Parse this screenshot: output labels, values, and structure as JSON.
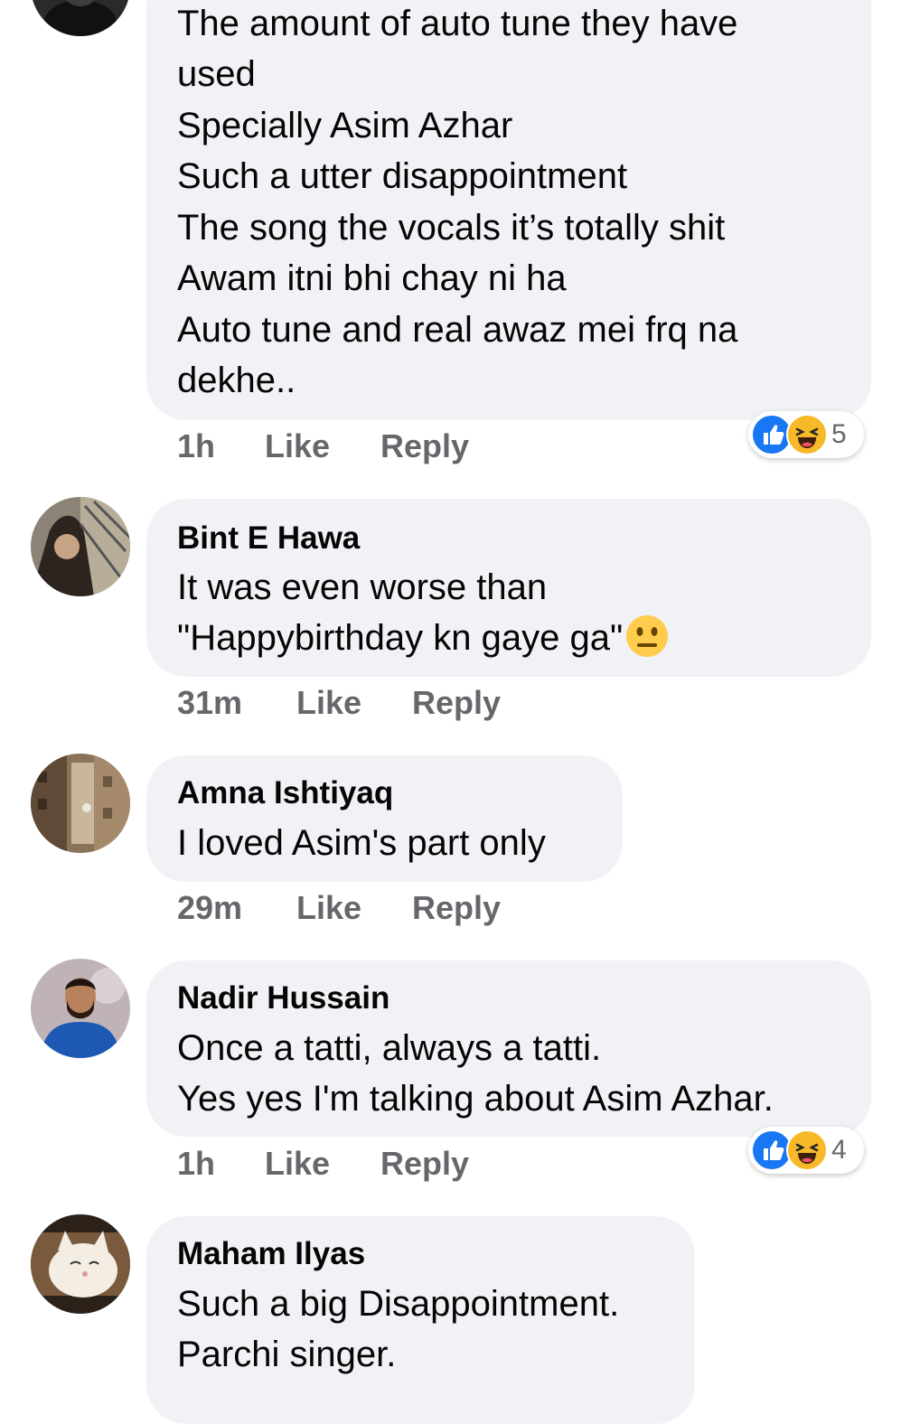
{
  "comments": [
    {
      "author": "",
      "lines": [
        "The amount of auto tune they have",
        "used",
        "Specially Asim Azhar",
        "Such a utter disappointment",
        "The song the vocals it’s totally shit",
        "Awam itni bhi chay ni ha",
        "Auto tune and real awaz mei frq na",
        "dekhe.."
      ],
      "time": "1h",
      "like_label": "Like",
      "reply_label": "Reply",
      "reaction_count": "5",
      "reactions": [
        "like-icon",
        "haha-icon"
      ]
    },
    {
      "author": "Bint E Hawa",
      "lines": [
        "It was even worse than",
        "\"Happybirthday kn gaye ga\""
      ],
      "emoji": "neutral-face-emoji",
      "time": "31m",
      "like_label": "Like",
      "reply_label": "Reply"
    },
    {
      "author": "Amna Ishtiyaq",
      "lines": [
        "I loved Asim's part only"
      ],
      "time": "29m",
      "like_label": "Like",
      "reply_label": "Reply"
    },
    {
      "author": "Nadir Hussain",
      "lines": [
        "Once a tatti, always a tatti.",
        "Yes yes I'm talking about Asim Azhar."
      ],
      "time": "1h",
      "like_label": "Like",
      "reply_label": "Reply",
      "reaction_count": "4",
      "reactions": [
        "like-icon",
        "haha-icon"
      ]
    },
    {
      "author": "Maham Ilyas",
      "lines": [
        "Such a big Disappointment.",
        "Parchi singer."
      ]
    }
  ],
  "colors": {
    "bubble": "#f0f2f5",
    "meta_text": "#65676b",
    "like_blue": "#1877f2",
    "haha_yellow": "#f7b928"
  }
}
